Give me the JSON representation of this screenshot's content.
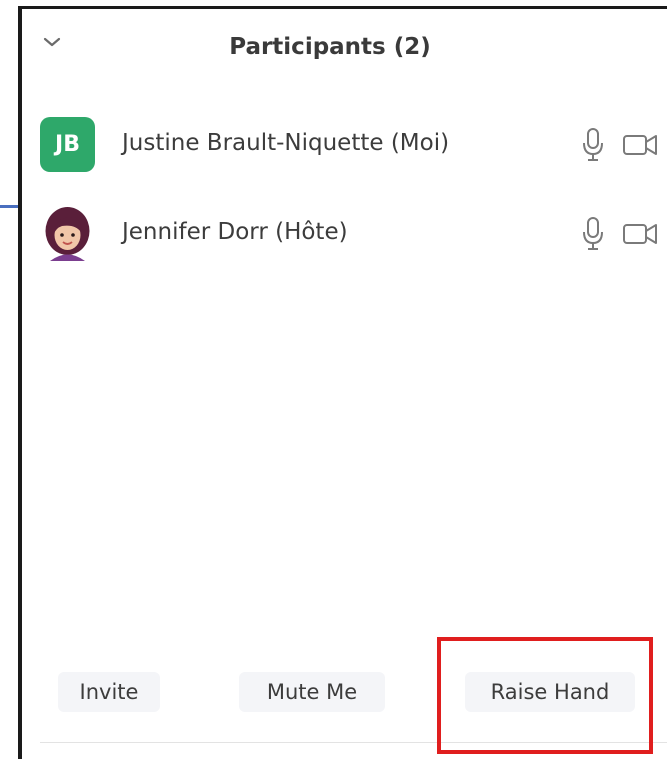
{
  "panel": {
    "title": "Participants (2)"
  },
  "participants": [
    {
      "initials": "JB",
      "name": "Justine Brault-Niquette (Moi)",
      "avatar_color": "#2ea86a"
    },
    {
      "name": "Jennifer Dorr (Hôte)",
      "avatar": "memoji-photo"
    }
  ],
  "footer": {
    "invite_label": "Invite",
    "mute_label": "Mute Me",
    "raise_hand_label": "Raise Hand"
  },
  "icons": {
    "collapse": "chevron-down-icon",
    "mic": "microphone-icon",
    "camera": "video-camera-icon"
  },
  "colors": {
    "highlight": "#e01e1e",
    "initials_avatar": "#2ea86a",
    "connector": "#4a6fbf"
  }
}
